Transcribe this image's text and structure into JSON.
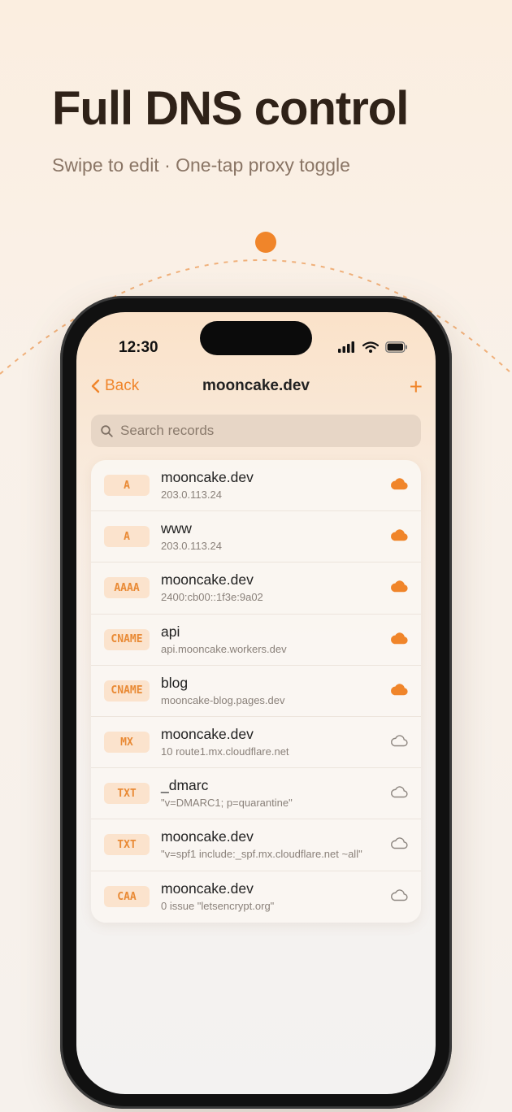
{
  "headline": "Full DNS control",
  "subline": "Swipe to edit · One-tap proxy toggle",
  "colors": {
    "accent": "#f0852a",
    "badge_bg": "#fbe3cd",
    "badge_text": "#e98a35"
  },
  "status_bar": {
    "time": "12:30",
    "icons": [
      "signal-icon",
      "wifi-icon",
      "battery-icon"
    ]
  },
  "nav": {
    "back_label": "Back",
    "title": "mooncake.dev",
    "add_label": "+"
  },
  "search": {
    "placeholder": "Search records"
  },
  "records": [
    {
      "type": "A",
      "name": "mooncake.dev",
      "value": "203.0.113.24",
      "proxied": true
    },
    {
      "type": "A",
      "name": "www",
      "value": "203.0.113.24",
      "proxied": true
    },
    {
      "type": "AAAA",
      "name": "mooncake.dev",
      "value": "2400:cb00::1f3e:9a02",
      "proxied": true
    },
    {
      "type": "CNAME",
      "name": "api",
      "value": "api.mooncake.workers.dev",
      "proxied": true
    },
    {
      "type": "CNAME",
      "name": "blog",
      "value": "mooncake-blog.pages.dev",
      "proxied": true
    },
    {
      "type": "MX",
      "name": "mooncake.dev",
      "value": "10 route1.mx.cloudflare.net",
      "proxied": false
    },
    {
      "type": "TXT",
      "name": "_dmarc",
      "value": "\"v=DMARC1; p=quarantine\"",
      "proxied": false
    },
    {
      "type": "TXT",
      "name": "mooncake.dev",
      "value": "\"v=spf1 include:_spf.mx.cloudflare.net ~all\"",
      "proxied": false
    },
    {
      "type": "CAA",
      "name": "mooncake.dev",
      "value": "0 issue \"letsencrypt.org\"",
      "proxied": false
    }
  ]
}
